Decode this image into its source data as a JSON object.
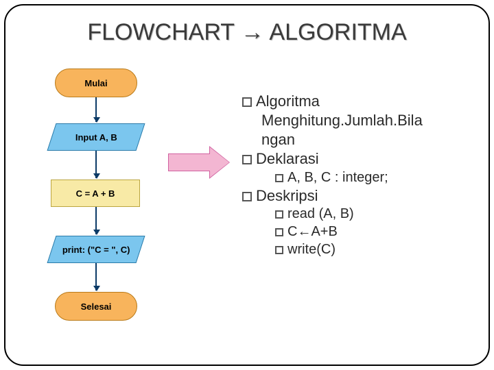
{
  "title": "FLOWCHART → ALGORITMA",
  "flow": {
    "start": "Mulai",
    "input": "Input A, B",
    "process": "C = A + B",
    "output": "print: (\"C = \", C)",
    "end": "Selesai"
  },
  "algo": {
    "header1": "Algoritma",
    "name_line1": "Menghitung.Jumlah.Bila",
    "name_line2": "ngan",
    "header2": "Deklarasi",
    "decl1": "A, B, C : integer;",
    "header3": "Deskripsi",
    "step1": "read (A, B)",
    "step2": "C←A+B",
    "step3": "write(C)"
  }
}
